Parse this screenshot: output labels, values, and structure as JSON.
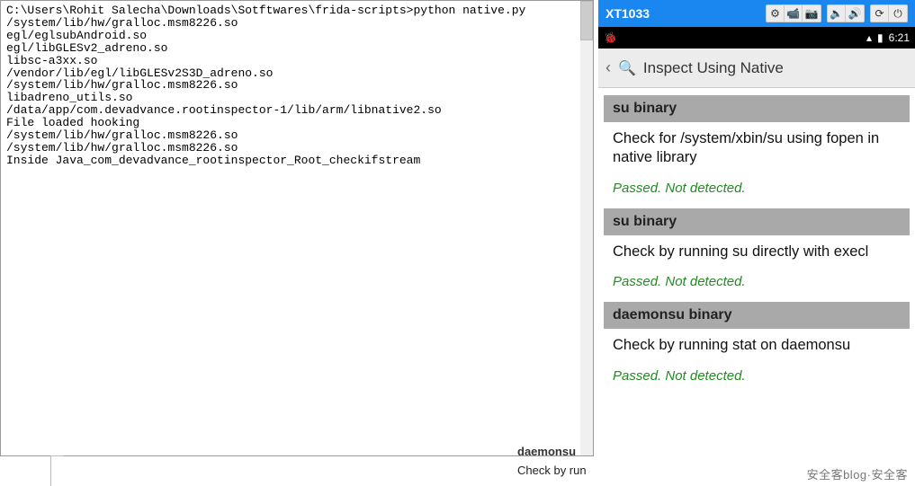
{
  "terminal": {
    "prompt": "C:\\Users\\Rohit Salecha\\Downloads\\Sotftwares\\frida-scripts>",
    "command": "python native.py",
    "lines": [
      "/system/lib/hw/gralloc.msm8226.so",
      "egl/eglsubAndroid.so",
      "egl/libGLESv2_adreno.so",
      "libsc-a3xx.so",
      "/vendor/lib/egl/libGLESv2S3D_adreno.so",
      "/system/lib/hw/gralloc.msm8226.so",
      "libadreno_utils.so",
      "/data/app/com.devadvance.rootinspector-1/lib/arm/libnative2.so",
      "File loaded hooking",
      "/system/lib/hw/gralloc.msm8226.so",
      "/system/lib/hw/gralloc.msm8226.so",
      "Inside Java_com_devadvance_rootinspector_Root_checkifstream"
    ]
  },
  "peek": {
    "header": "daemonsu",
    "desc": "Check by run"
  },
  "device": {
    "name": "XT1033",
    "toolbar_icons": {
      "gear": "⚙",
      "camv": "📹",
      "cam": "📷",
      "vdn": "🔈",
      "vup": "🔊",
      "rot": "⟳",
      "pow": "⏻"
    },
    "status": {
      "time": "6:21",
      "bug": "🐞",
      "signal": "▴",
      "batt": "▮"
    },
    "app_title": "Inspect Using Native",
    "back_icon": "‹",
    "search_icon": "🔍",
    "items": [
      {
        "h": "su binary",
        "d": "Check for /system/xbin/su using fopen in native library",
        "s": "Passed. Not detected."
      },
      {
        "h": "su binary",
        "d": "Check by running su directly with execl",
        "s": "Passed. Not detected."
      },
      {
        "h": "daemonsu binary",
        "d": "Check by running stat on daemonsu",
        "s": "Passed. Not detected."
      }
    ]
  },
  "watermark": "安全客blog·安全客"
}
